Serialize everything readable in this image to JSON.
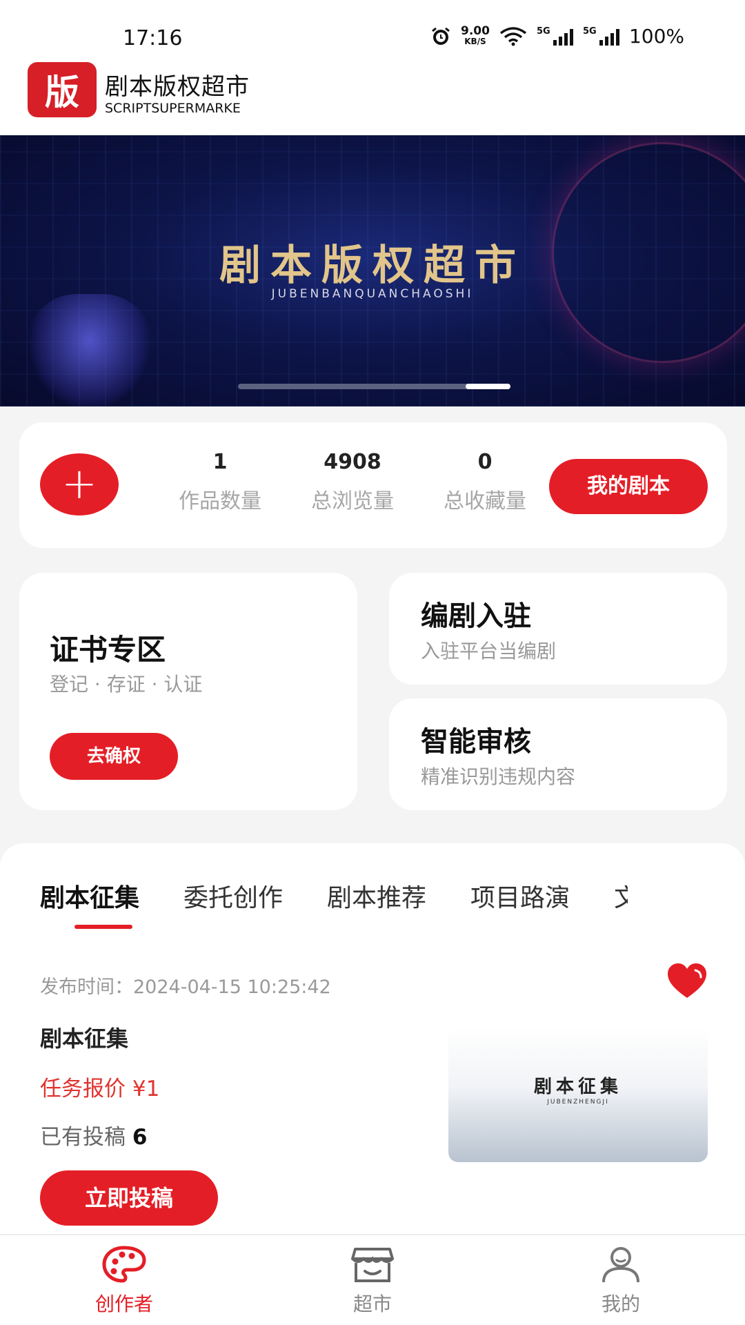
{
  "status_bar": {
    "time": "17:16",
    "net_speed_value": "9.00",
    "net_speed_unit": "KB/S",
    "sim1": "5G",
    "sim2": "5G",
    "battery": "100%"
  },
  "header": {
    "logo_char": "版",
    "title": "剧本版权超市",
    "subtitle": "SCRIPTSUPERMARKE"
  },
  "banner": {
    "title": "剧本版权超市",
    "subtitle": "JUBENBANQUANCHAOSHI"
  },
  "stats": {
    "add_label": "+",
    "items": [
      {
        "value": "1",
        "label": "作品数量"
      },
      {
        "value": "4908",
        "label": "总浏览量"
      },
      {
        "value": "0",
        "label": "总收藏量"
      }
    ],
    "my_scripts_label": "我的剧本"
  },
  "cert_card": {
    "title": "证书专区",
    "subtitle": "登记 · 存证 · 认证",
    "button": "去确权"
  },
  "feature_cards": [
    {
      "title": "编剧入驻",
      "subtitle": "入驻平台当编剧"
    },
    {
      "title": "智能审核",
      "subtitle": "精准识别违规内容"
    }
  ],
  "tabs": [
    "剧本征集",
    "委托创作",
    "剧本推荐",
    "项目路演",
    "文"
  ],
  "listing": {
    "publish_time": "发布时间：2024-04-15 10:25:42",
    "title": "剧本征集",
    "price": "任务报价 ¥1",
    "submissions_label": "已有投稿",
    "submissions_count": "6",
    "thumb_title": "剧本征集",
    "thumb_subtitle": "JUBENZHENGJI",
    "submit_label": "立即投稿"
  },
  "bottom_nav": [
    {
      "label": "创作者",
      "icon": "palette-icon",
      "active": true
    },
    {
      "label": "超市",
      "icon": "store-icon",
      "active": false
    },
    {
      "label": "我的",
      "icon": "user-icon",
      "active": false
    }
  ],
  "colors": {
    "accent": "#e41e26",
    "banner_gold": "#e2c58a",
    "banner_bg": "#0d1448"
  }
}
